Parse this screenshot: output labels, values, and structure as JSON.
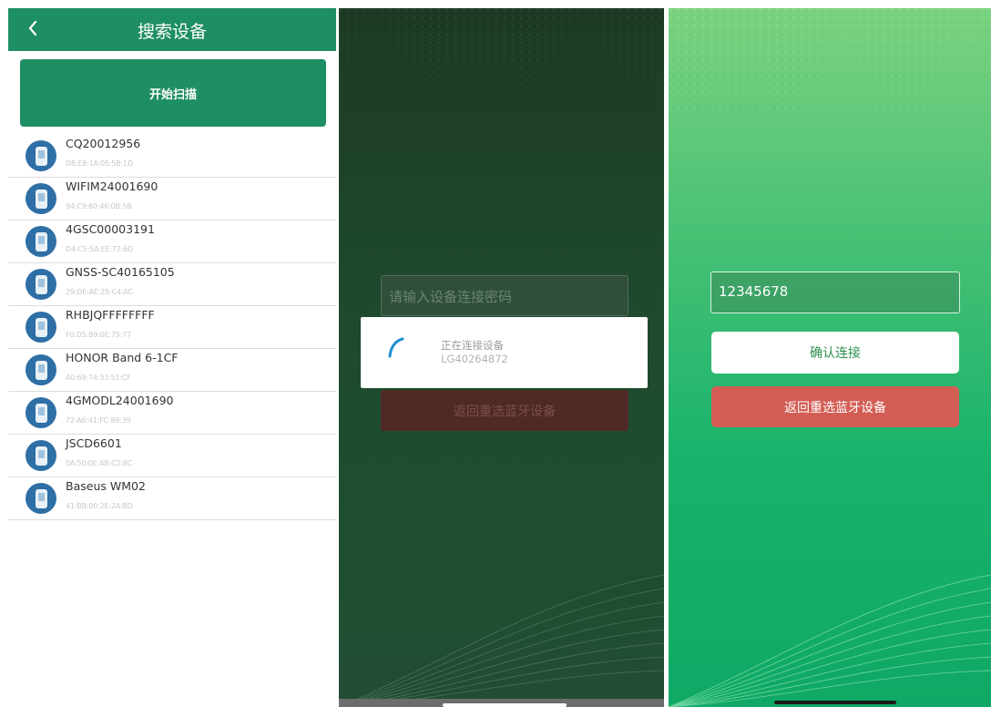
{
  "panel1": {
    "header_title": "搜索设备",
    "back_icon": "chevron-left-icon",
    "scan_label": "开始扫描",
    "devices": [
      {
        "name": "CQ20012956",
        "mac": "D8:E8:1A:05:5B:1D"
      },
      {
        "name": "WIFIM24001690",
        "mac": "94:C9:60:46:0B:5B"
      },
      {
        "name": "4GSC00003191",
        "mac": "D4:C5:5A:EE:72:6D"
      },
      {
        "name": "GNSS-SC40165105",
        "mac": "29:DE:AE:25:C4:AC"
      },
      {
        "name": "RHBJQFFFFFFFF",
        "mac": "F0:D5:B9:0E:75:77"
      },
      {
        "name": "HONOR Band 6-1CF",
        "mac": "A0:69:74:33:51:CF"
      },
      {
        "name": "4GMODL24001690",
        "mac": "72:A6:41:FC:89:39"
      },
      {
        "name": "JSCD6601",
        "mac": "0A:50:0E:AB:C2:8C"
      },
      {
        "name": "Baseus WM02",
        "mac": "41:BB:00:2E:2A:BD"
      }
    ],
    "colors": {
      "accent": "#1e8e63",
      "icon": "#2e6fa6"
    }
  },
  "panel2": {
    "password_placeholder": "请输入设备连接密码",
    "back_button": "返回重选蓝牙设备",
    "dialog_message": "正在连接设备",
    "dialog_device": "LG40264872"
  },
  "panel3": {
    "password_value": "12345678",
    "confirm_button": "确认连接",
    "back_button": "返回重选蓝牙设备",
    "colors": {
      "back_button": "#d35d55"
    }
  }
}
